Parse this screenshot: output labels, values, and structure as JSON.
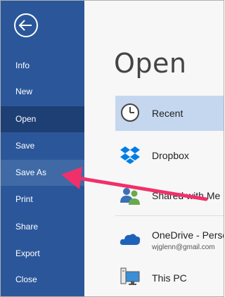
{
  "sidebar": {
    "items": [
      {
        "label": "Info"
      },
      {
        "label": "New"
      },
      {
        "label": "Open"
      },
      {
        "label": "Save"
      },
      {
        "label": "Save As"
      },
      {
        "label": "Print"
      },
      {
        "label": "Share"
      },
      {
        "label": "Export"
      },
      {
        "label": "Close"
      }
    ]
  },
  "main": {
    "title": "Open",
    "locations": [
      {
        "label": "Recent",
        "icon": "clock-icon"
      },
      {
        "label": "Dropbox",
        "icon": "dropbox-icon"
      },
      {
        "label": "Shared with Me",
        "icon": "people-icon"
      },
      {
        "label": "OneDrive - Perso",
        "sub": "wjglenn@gmail.com",
        "icon": "cloud-icon"
      },
      {
        "label": "This PC",
        "icon": "computer-icon"
      }
    ]
  },
  "colors": {
    "sidebar": "#2b579a",
    "sidebar_active": "#1e3f73",
    "selected_location": "#c5d7ef",
    "annotation_arrow": "#f0306a"
  }
}
